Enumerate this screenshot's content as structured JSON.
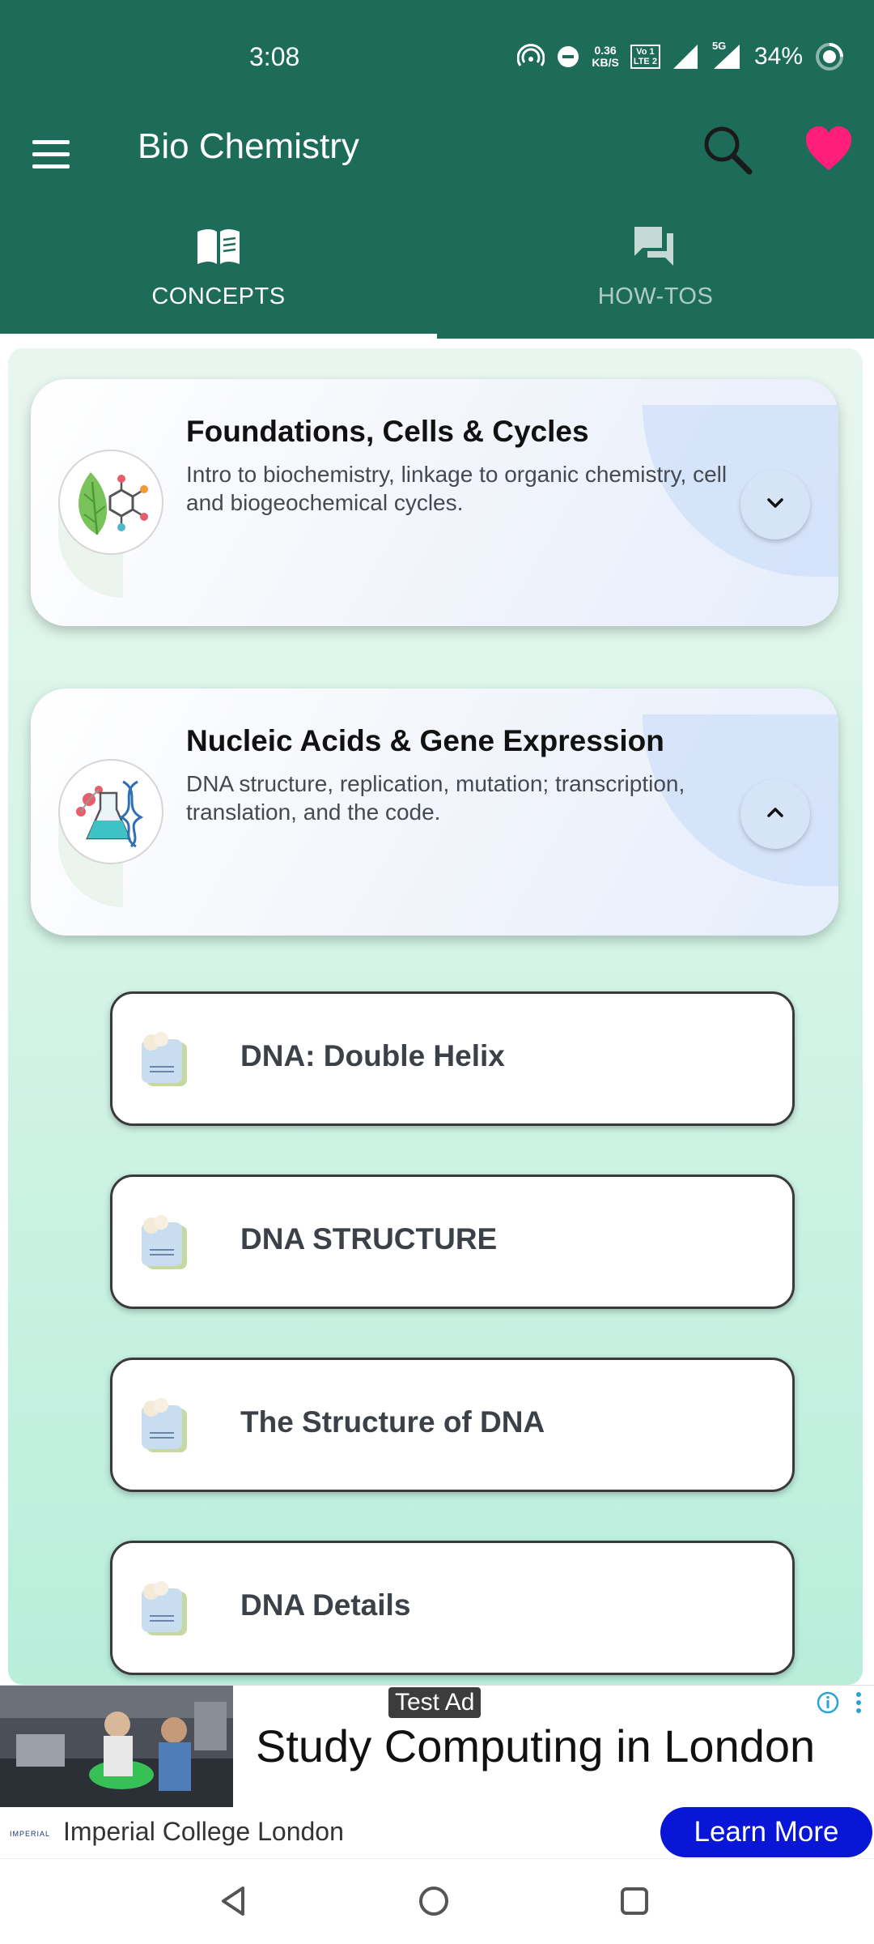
{
  "status_bar": {
    "time": "3:08",
    "net_speed_value": "0.36",
    "net_speed_unit": "KB/S",
    "volte_top": "Vo 1",
    "volte_bottom": "LTE 2",
    "network_type": "5G",
    "battery_percent": "34%"
  },
  "app_bar": {
    "title": "Bio Chemistry",
    "menu_icon": "menu-icon",
    "search_icon": "search-icon",
    "favorite_icon": "heart-icon",
    "favorite_color": "#ff1f7a"
  },
  "tabs": [
    {
      "label": "CONCEPTS",
      "icon": "book-icon",
      "selected": true
    },
    {
      "label": "HOW-TOS",
      "icon": "chat-icon",
      "selected": false
    }
  ],
  "topics": [
    {
      "title": "Foundations, Cells & Cycles",
      "description": "Intro to biochemistry, linkage to organic chemistry, cell and biogeochemical cycles.",
      "icon": "leaf-molecule-icon",
      "expanded": false
    },
    {
      "title": "Nucleic Acids & Gene Expression",
      "description": "DNA structure, replication, mutation; transcription, translation, and the code.",
      "icon": "flask-dna-icon",
      "expanded": true
    }
  ],
  "lessons": [
    {
      "label": "DNA: Double Helix",
      "icon": "document-icon"
    },
    {
      "label": "DNA STRUCTURE",
      "icon": "document-icon"
    },
    {
      "label": "The Structure of DNA",
      "icon": "document-icon"
    },
    {
      "label": "DNA Details",
      "icon": "document-icon"
    }
  ],
  "ad": {
    "tag": "Test Ad",
    "headline": "Study Computing in London",
    "logo_text": "IMPERIAL",
    "advertiser": "Imperial College London",
    "cta": "Learn More",
    "cta_color": "#0a16d6"
  },
  "colors": {
    "primary": "#1d6b59",
    "content_bg": "#c8f1e2"
  }
}
